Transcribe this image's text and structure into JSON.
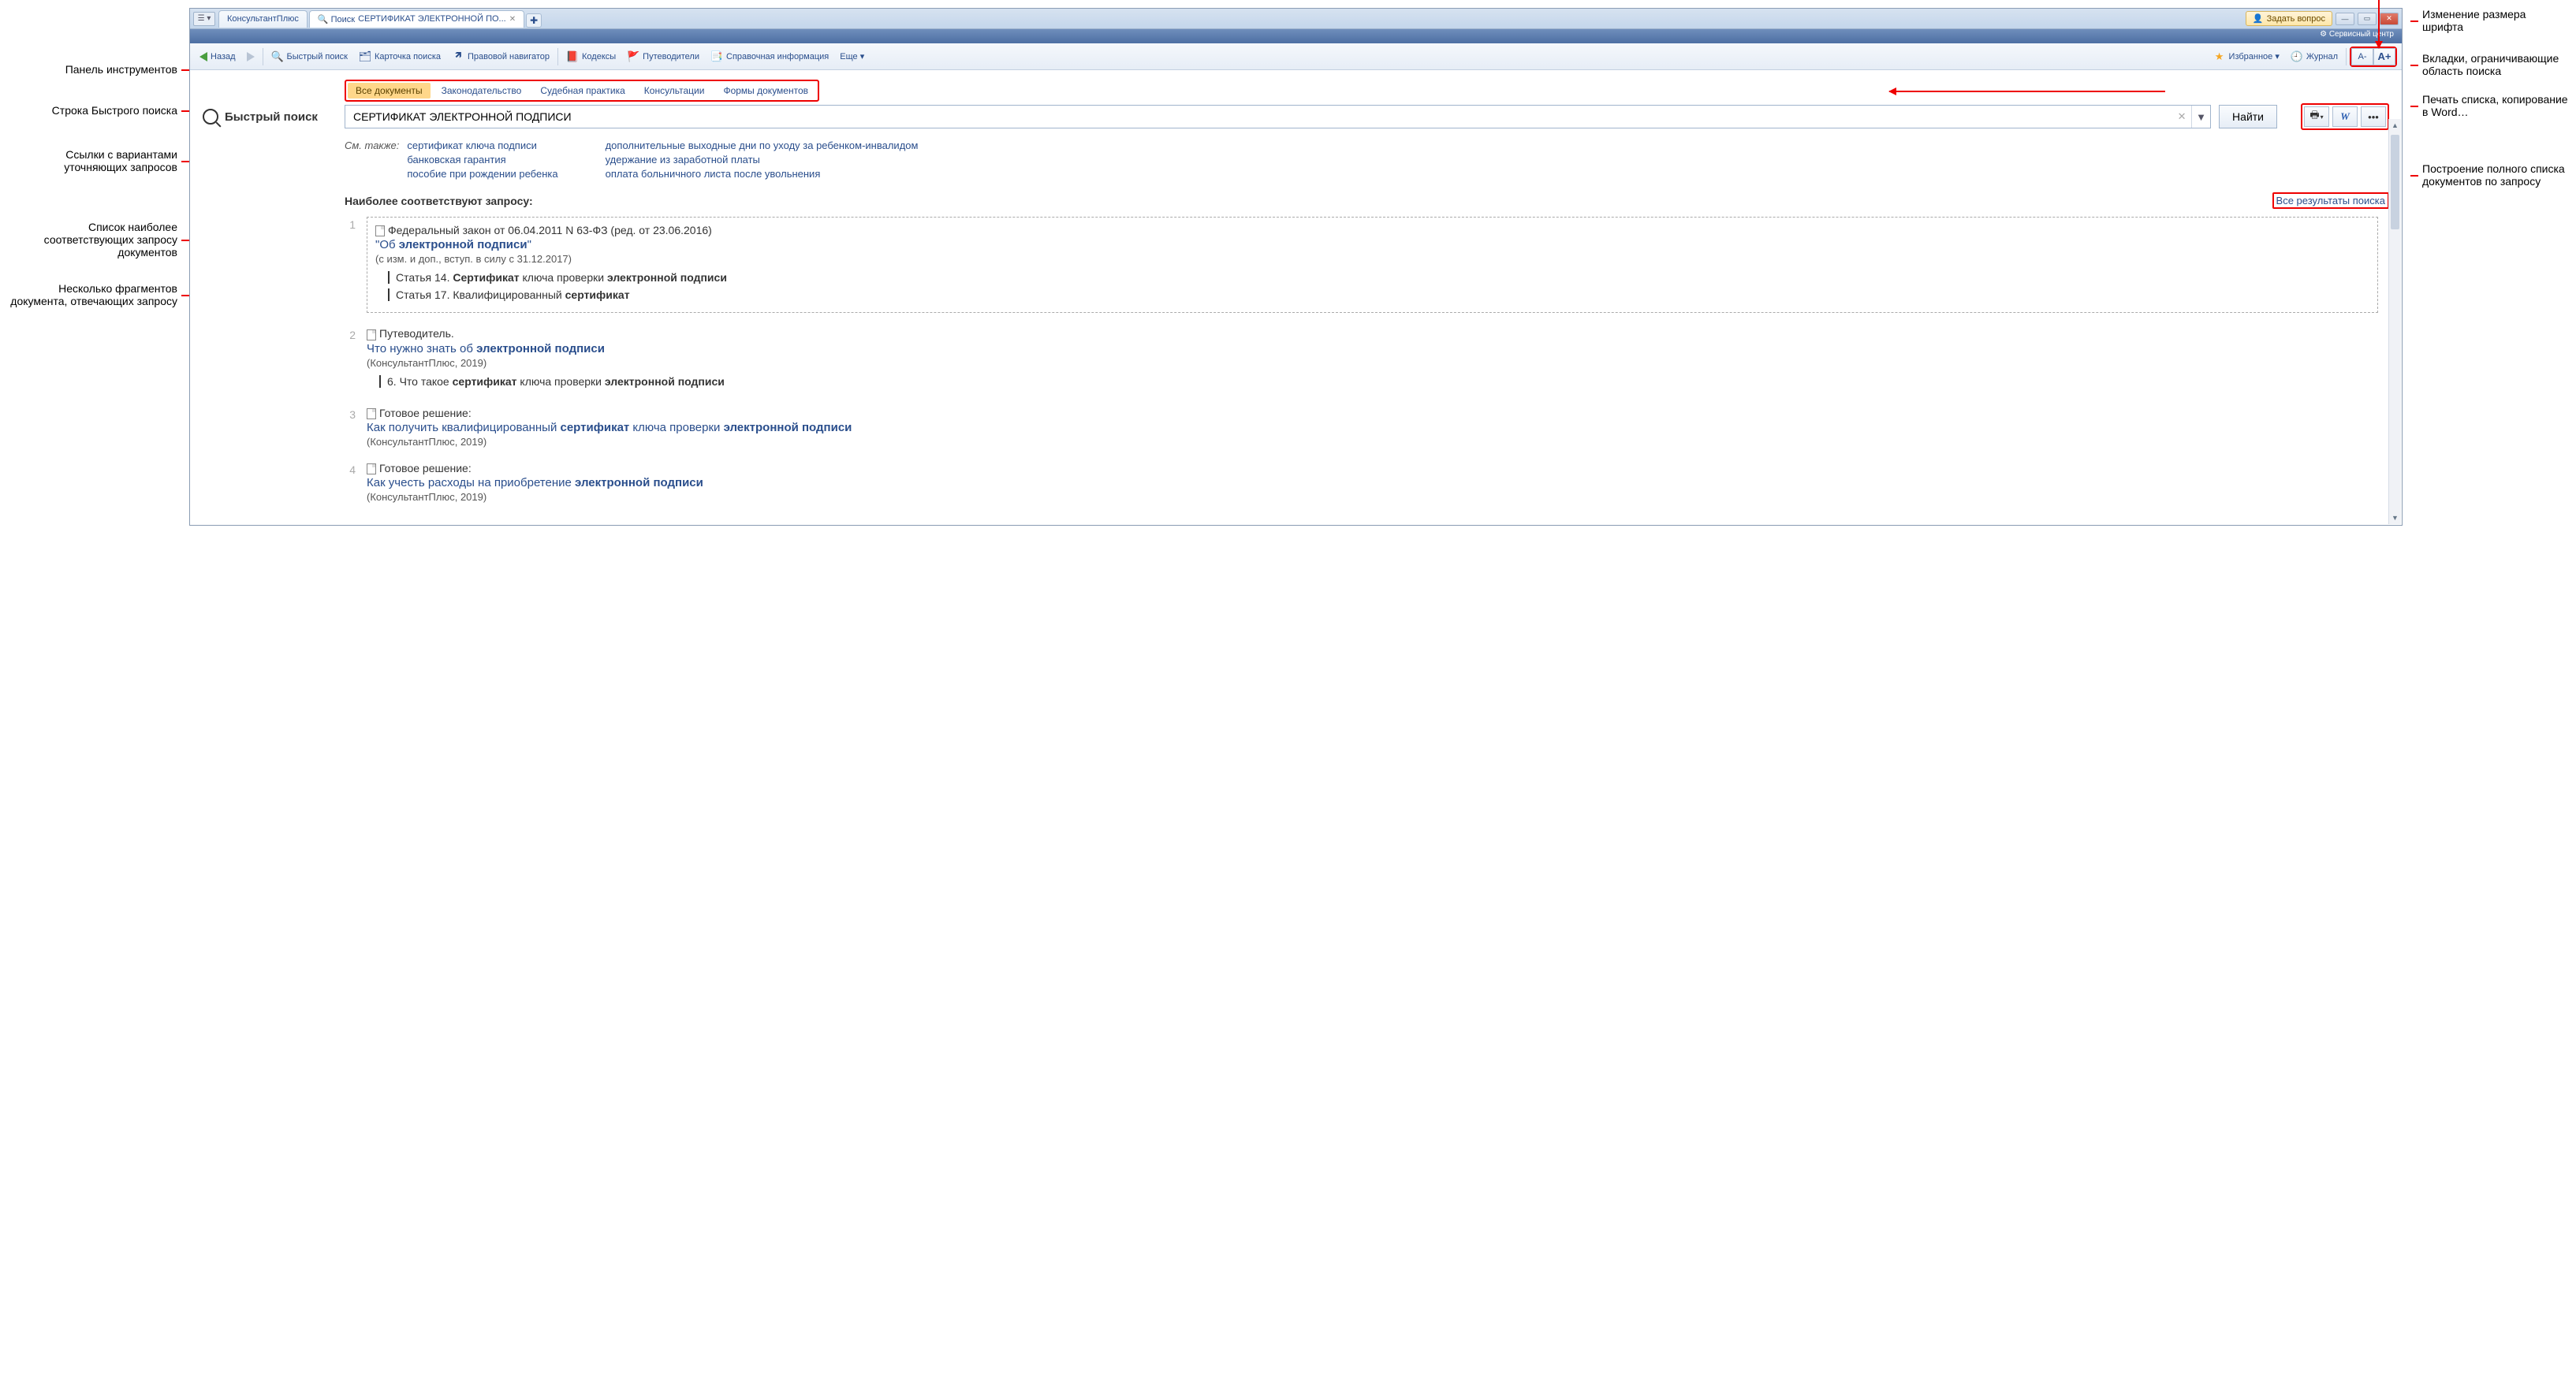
{
  "annotations": {
    "left": {
      "toolbar": "Панель инструментов",
      "quicksearch": "Строка Быстрого поиска",
      "links": "Ссылки с вариантами уточняющих запросов",
      "list": "Список наиболее соответствующих запросу документов",
      "fragments": "Несколько фрагментов документа, отвечающих запросу"
    },
    "right": {
      "fontsize": "Изменение размера шрифта",
      "tabs": "Вкладки, ограничивающие область поиска",
      "print": "Печать списка, копирование в Word…",
      "fulllist": "Построение полного списка документов по запросу"
    }
  },
  "titlebar": {
    "menu": "☰ ▾",
    "home_tab": "КонсультантПлюс",
    "search_tab_prefix": "🔍 Поиск",
    "search_tab_text": "СЕРТИФИКАТ ЭЛЕКТРОННОЙ ПО...",
    "ask": "Задать вопрос",
    "service": "⚙ Сервисный центр"
  },
  "toolbar": {
    "back": "Назад",
    "quick_search": "Быстрый поиск",
    "card": "Карточка поиска",
    "navigator": "Правовой навигатор",
    "codex": "Кодексы",
    "guides": "Путеводители",
    "info": "Справочная информация",
    "more": "Еще ▾",
    "favorites": "Избранное ▾",
    "journal": "Журнал",
    "font_minus": "A-",
    "font_plus": "A+"
  },
  "search": {
    "label": "Быстрый поиск",
    "tabs": [
      "Все документы",
      "Законодательство",
      "Судебная практика",
      "Консультации",
      "Формы документов"
    ],
    "value": "СЕРТИФИКАТ ЭЛЕКТРОННОЙ ПОДПИСИ",
    "button": "Найти"
  },
  "see_also": {
    "label": "См. также:",
    "col1": [
      "сертификат ключа подписи",
      "банковская гарантия",
      "пособие при рождении ребенка"
    ],
    "col2": [
      "дополнительные выходные дни по уходу за ребенком-инвалидом",
      "удержание из заработной платы",
      "оплата больничного листа после увольнения"
    ]
  },
  "results_header": {
    "title": "Наиболее соответствуют запросу:",
    "all": "Все результаты поиска"
  },
  "results": [
    {
      "num": "1",
      "meta": "Федеральный закон от 06.04.2011 N 63-ФЗ (ред. от 23.06.2016)",
      "title_html": "\"Об <b>электронной подписи</b>\"",
      "note": "(с изм. и доп., вступ. в силу с 31.12.2017)",
      "fragments": [
        "Статья 14. <b>Сертификат</b> ключа проверки <b>электронной подписи</b>",
        "Статья 17. Квалифицированный <b>сертификат</b>"
      ],
      "boxed": true
    },
    {
      "num": "2",
      "meta": "Путеводитель.",
      "title_html": "Что нужно знать об <b>электронной подписи</b>",
      "note": "(КонсультантПлюс, 2019)",
      "fragments": [
        "6. Что такое <b>сертификат</b> ключа проверки <b>электронной подписи</b>"
      ]
    },
    {
      "num": "3",
      "meta": "Готовое решение:",
      "title_html": "Как получить квалифицированный <b>сертификат</b> ключа проверки <b>электронной подписи</b>",
      "note": "(КонсультантПлюс, 2019)"
    },
    {
      "num": "4",
      "meta": "Готовое решение:",
      "title_html": "Как учесть расходы на приобретение <b>электронной подписи</b>",
      "note": "(КонсультантПлюс, 2019)"
    }
  ]
}
